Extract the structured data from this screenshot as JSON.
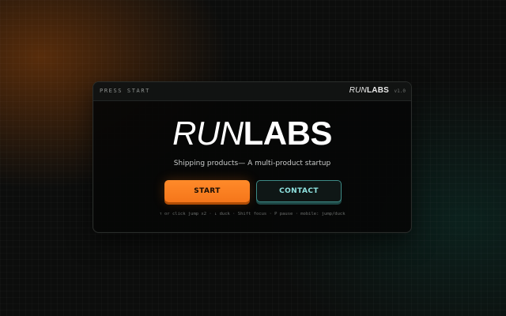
{
  "topbar": {
    "press_start": "PRESS START",
    "brand_light": "RUN",
    "brand_bold": "LABS",
    "version": "v1.0"
  },
  "hero": {
    "logo_light": "RUN",
    "logo_bold": "LABS",
    "tagline": "Shipping products— A multi-product startup"
  },
  "buttons": {
    "start_label": "START",
    "contact_label": "CONTACT"
  },
  "controls_hint": "↑ or click jump x2 · ↓ duck · Shift focus · P pause · mobile: jump/duck",
  "colors": {
    "accent_orange": "#f5761a",
    "accent_teal": "#8fe3e0",
    "background": "#0c0d0c"
  }
}
